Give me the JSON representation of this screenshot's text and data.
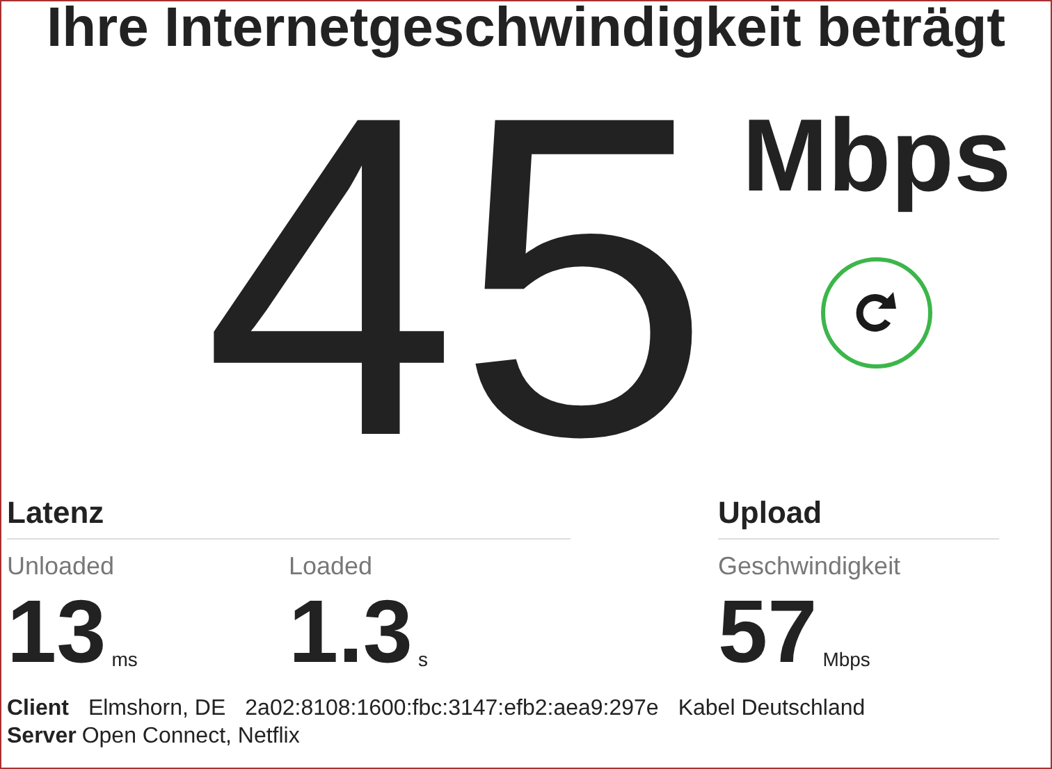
{
  "title": "Ihre Internetgeschwindigkeit beträgt",
  "speed": {
    "value": "45",
    "unit": "Mbps"
  },
  "latency": {
    "heading": "Latenz",
    "metrics": [
      {
        "label": "Unloaded",
        "value": "13",
        "unit": "ms"
      },
      {
        "label": "Loaded",
        "value": "1.3",
        "unit": "s"
      }
    ]
  },
  "upload": {
    "heading": "Upload",
    "metrics": [
      {
        "label": "Geschwindigkeit",
        "value": "57",
        "unit": "Mbps"
      }
    ]
  },
  "client": {
    "label": "Client",
    "parts": [
      "Elmshorn, DE",
      "2a02:8108:1600:fbc:3147:efb2:aea9:297e",
      "Kabel Deutschland"
    ]
  },
  "server": {
    "label": "Server",
    "text": "Open Connect, Netflix"
  }
}
